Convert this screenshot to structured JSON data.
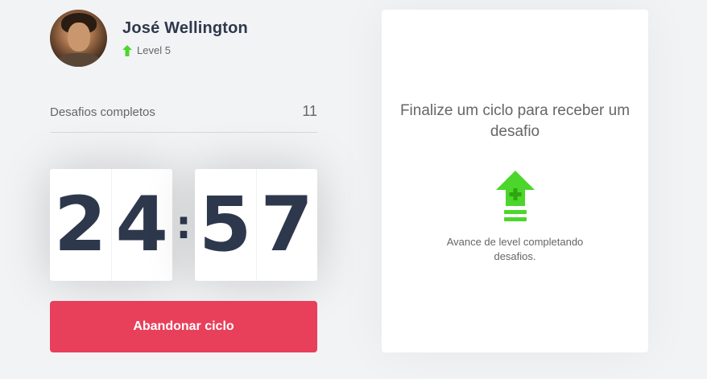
{
  "profile": {
    "name": "José Wellington",
    "level_label": "Level 5"
  },
  "challenges": {
    "label": "Desafios completos",
    "count": "11"
  },
  "countdown": {
    "minutes": [
      "2",
      "4"
    ],
    "separator": ":",
    "seconds": [
      "5",
      "7"
    ]
  },
  "actions": {
    "abandon_label": "Abandonar ciclo"
  },
  "challenge_panel": {
    "title": "Finalize um ciclo para receber um desafio",
    "description": "Avance de level completando desafios."
  },
  "icons": {
    "level": "level-up-arrow-icon",
    "panel": "level-up-arrow-plus-icon"
  },
  "colors": {
    "accent_green": "#4cd62b",
    "danger_red": "#e83f5b",
    "title_dark": "#2e384d",
    "text": "#666666",
    "background": "#f2f3f5"
  }
}
